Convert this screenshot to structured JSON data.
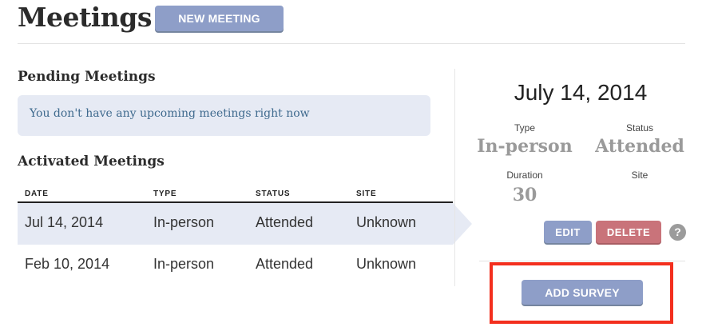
{
  "header": {
    "title": "Meetings",
    "new_meeting_label": "NEW MEETING"
  },
  "pending": {
    "title": "Pending Meetings",
    "empty_message": "You don't have any upcoming meetings right now"
  },
  "activated": {
    "title": "Activated Meetings",
    "columns": [
      "DATE",
      "TYPE",
      "STATUS",
      "SITE"
    ],
    "rows": [
      {
        "date": "Jul 14, 2014",
        "type": "In-person",
        "status": "Attended",
        "site": "Unknown",
        "selected": true
      },
      {
        "date": "Feb 10, 2014",
        "type": "In-person",
        "status": "Attended",
        "site": "Unknown",
        "selected": false
      }
    ]
  },
  "detail": {
    "date": "July 14, 2014",
    "type_label": "Type",
    "type_value": "In-person",
    "status_label": "Status",
    "status_value": "Attended",
    "duration_label": "Duration",
    "duration_value": "30",
    "site_label": "Site",
    "site_value": "",
    "edit_label": "EDIT",
    "delete_label": "DELETE",
    "help_glyph": "?",
    "add_survey_label": "ADD SURVEY"
  },
  "colors": {
    "primary_button": "#8e9ec8",
    "danger_button": "#c9737a",
    "selected_row": "#e6eaf4",
    "highlight_box": "#f32f1e"
  },
  "icons": {
    "help": "question-circle-icon"
  }
}
